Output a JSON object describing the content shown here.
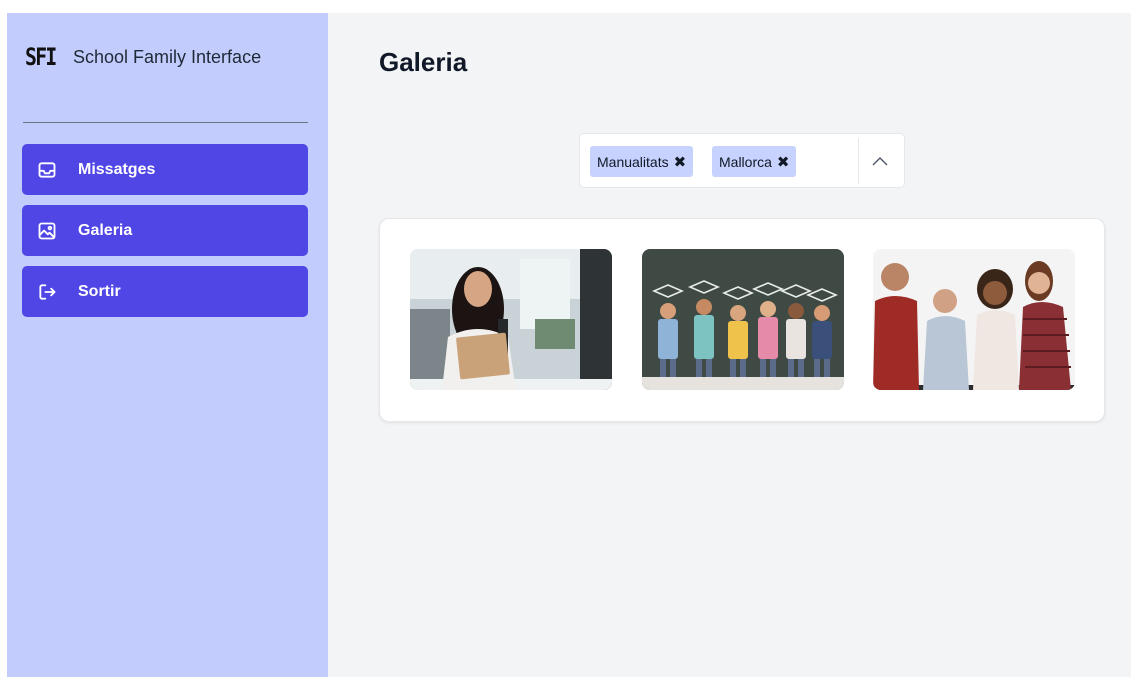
{
  "brand": {
    "logo_text": "SFI",
    "name": "School Family Interface"
  },
  "sidebar": {
    "items": [
      {
        "label": "Missatges",
        "icon": "inbox-icon"
      },
      {
        "label": "Galeria",
        "icon": "image-icon"
      },
      {
        "label": "Sortir",
        "icon": "logout-icon"
      }
    ]
  },
  "main": {
    "title": "Galeria",
    "filter": {
      "chips": [
        {
          "label": "Manualitats",
          "remove_icon": "close-icon"
        },
        {
          "label": "Mallorca",
          "remove_icon": "close-icon"
        }
      ],
      "toggle_icon": "chevron-up-icon"
    },
    "gallery": {
      "images": [
        {
          "subject": "student girl holding notebook"
        },
        {
          "subject": "children with graduation caps drawn on chalkboard"
        },
        {
          "subject": "group of four students"
        }
      ]
    }
  },
  "colors": {
    "sidebar_bg": "#c3cdfd",
    "nav_button": "#4f46e5",
    "chip_bg": "#c7d2fe",
    "main_bg": "#f3f4f6"
  }
}
